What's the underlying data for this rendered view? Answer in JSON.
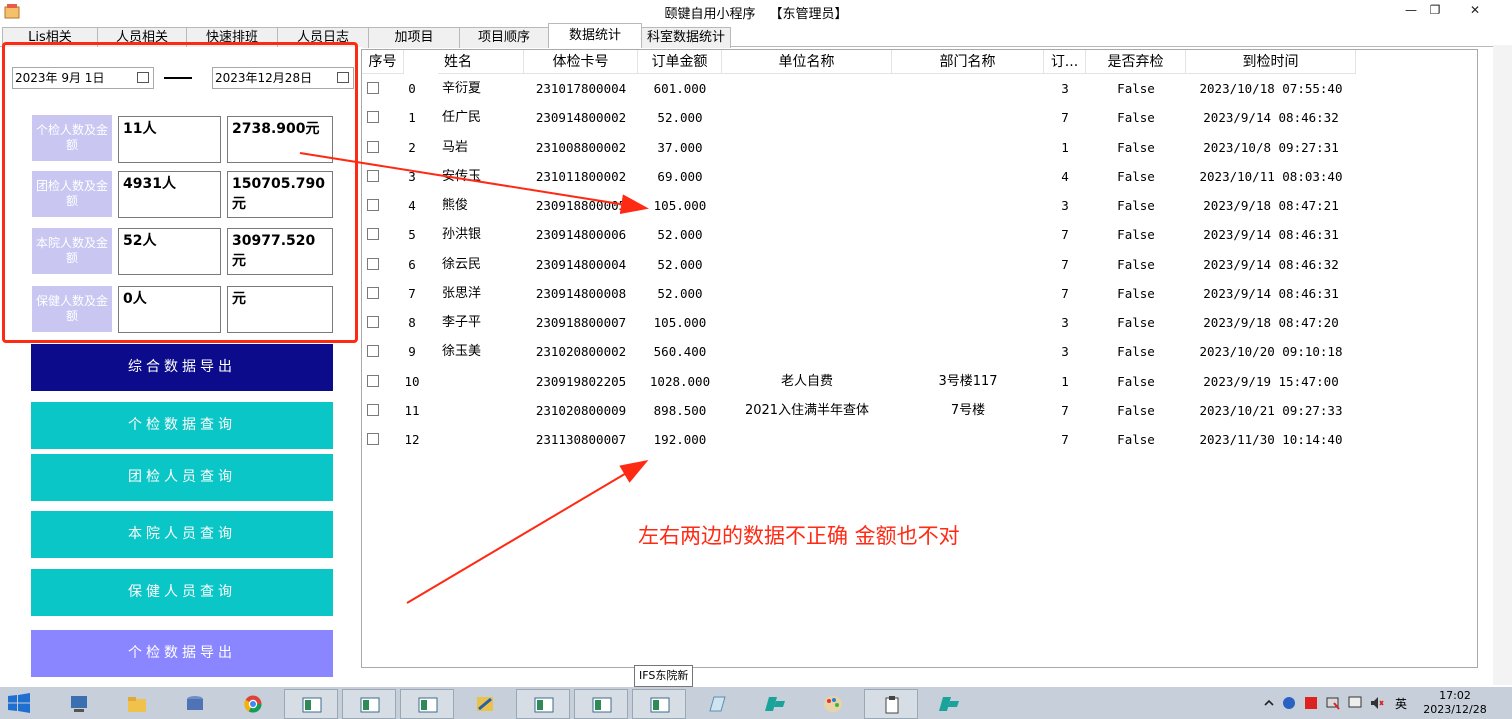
{
  "window": {
    "title": "颐键自用小程序",
    "role": "【东管理员】",
    "minimize": "—",
    "restore": "❐",
    "close": "✕"
  },
  "tabs": [
    "Lis相关",
    "人员相关",
    "快速排班",
    "人员日志",
    "加项目",
    "项目顺序",
    "数据统计",
    "科室数据统计"
  ],
  "active_tab": "数据统计",
  "filters": {
    "start_date": "2023年 9月 1日",
    "end_date": "2023年12月28日"
  },
  "stats": [
    {
      "label": "个检人数及金额",
      "count": "11人",
      "amount": "2738.900元"
    },
    {
      "label": "团检人数及金额",
      "count": "4931人",
      "amount": "150705.790元"
    },
    {
      "label": "本院人数及金额",
      "count": "52人",
      "amount": "30977.520元"
    },
    {
      "label": "保健人数及金额",
      "count": "0人",
      "amount": "元"
    }
  ],
  "buttons": {
    "export_all": "综合数据导出",
    "query_individual": "个检数据查询",
    "query_group": "团检人员查询",
    "query_staff": "本院人员查询",
    "query_health": "保健人员查询",
    "export_individual": "个检数据导出"
  },
  "table": {
    "columns": [
      "序号",
      "姓名",
      "体检卡号",
      "订单金额",
      "单位名称",
      "部门名称",
      "订...",
      "是否弃检",
      "到检时间"
    ],
    "rows": [
      [
        "0",
        "辛衍夏",
        "231017800004",
        "601.000",
        "",
        "",
        "3",
        "False",
        "2023/10/18 07:55:40"
      ],
      [
        "1",
        "任广民",
        "230914800002",
        "52.000",
        "",
        "",
        "7",
        "False",
        "2023/9/14 08:46:32"
      ],
      [
        "2",
        "马岩",
        "231008800002",
        "37.000",
        "",
        "",
        "1",
        "False",
        "2023/10/8 09:27:31"
      ],
      [
        "3",
        "安传玉",
        "231011800002",
        "69.000",
        "",
        "",
        "4",
        "False",
        "2023/10/11 08:03:40"
      ],
      [
        "4",
        "熊俊",
        "230918800005",
        "105.000",
        "",
        "",
        "3",
        "False",
        "2023/9/18 08:47:21"
      ],
      [
        "5",
        "孙洪银",
        "230914800006",
        "52.000",
        "",
        "",
        "7",
        "False",
        "2023/9/14 08:46:31"
      ],
      [
        "6",
        "徐云民",
        "230914800004",
        "52.000",
        "",
        "",
        "7",
        "False",
        "2023/9/14 08:46:32"
      ],
      [
        "7",
        "张思洋",
        "230914800008",
        "52.000",
        "",
        "",
        "7",
        "False",
        "2023/9/14 08:46:31"
      ],
      [
        "8",
        "李子平",
        "230918800007",
        "105.000",
        "",
        "",
        "3",
        "False",
        "2023/9/18 08:47:20"
      ],
      [
        "9",
        "徐玉美",
        "231020800002",
        "560.400",
        "",
        "",
        "3",
        "False",
        "2023/10/20 09:10:18"
      ],
      [
        "10",
        "",
        "230919802205",
        "1028.000",
        "老人自费",
        "3号楼117",
        "1",
        "False",
        "2023/9/19 15:47:00"
      ],
      [
        "11",
        "",
        "231020800009",
        "898.500",
        "2021入住满半年查体",
        "7号楼",
        "7",
        "False",
        "2023/10/21 09:27:33"
      ],
      [
        "12",
        "",
        "231130800007",
        "192.000",
        "",
        "",
        "7",
        "False",
        "2023/11/30 10:14:40"
      ]
    ]
  },
  "annotation": "左右两边的数据不正确 金额也不对",
  "tooltip": "IFS东院新",
  "taskbar": {
    "ime": "英",
    "time": "17:02",
    "date": "2023/12/28"
  },
  "colors": {
    "navy": "#0b0b8c",
    "teal": "#0ac6c6",
    "purple": "#8a86ff",
    "label_bg": "#c9c6f2",
    "annotation_red": "#ff2a14"
  }
}
